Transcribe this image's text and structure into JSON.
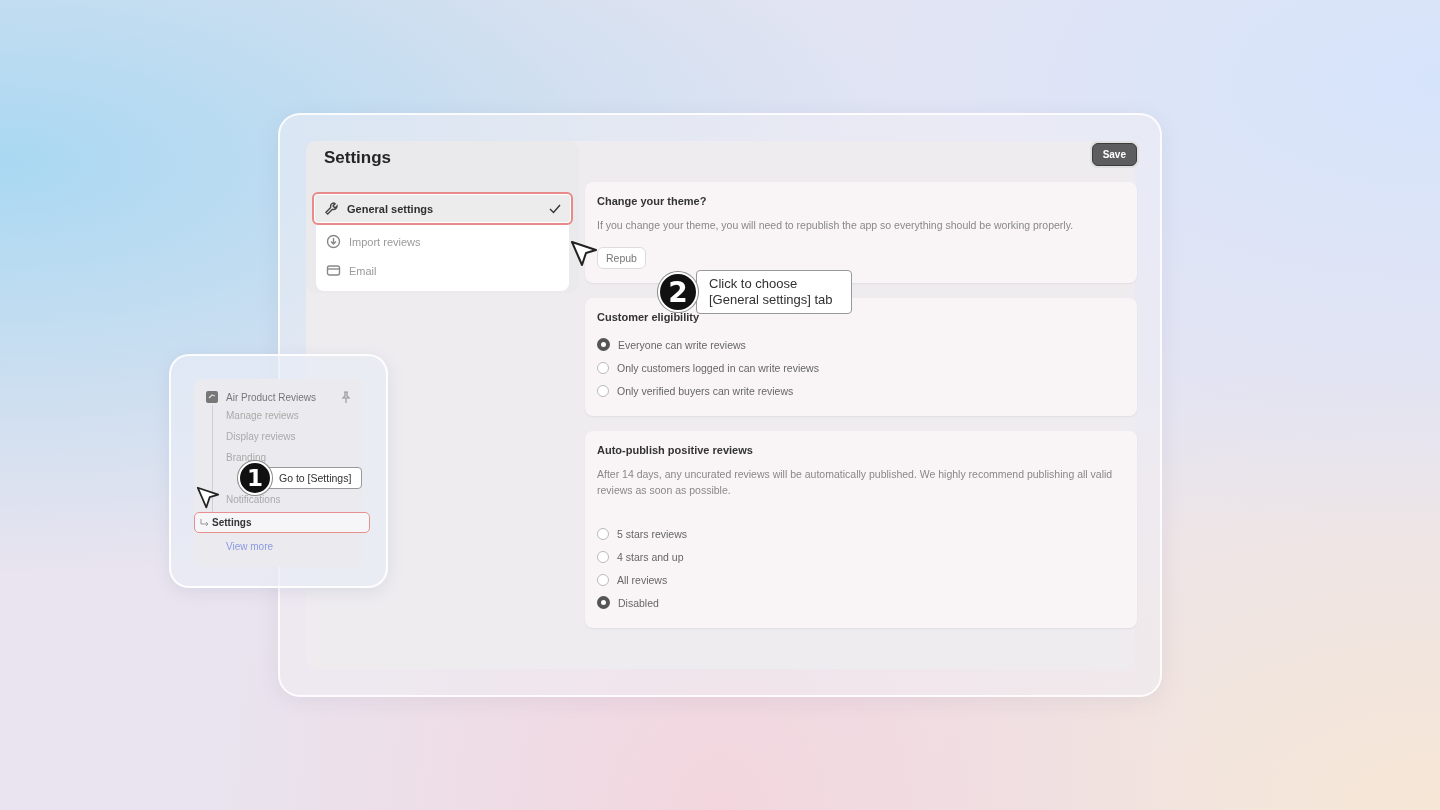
{
  "settings": {
    "title": "Settings",
    "save_button": "Save",
    "nav": [
      {
        "label": "General settings",
        "selected": true
      },
      {
        "label": "Import reviews",
        "selected": false
      },
      {
        "label": "Email",
        "selected": false
      }
    ],
    "cards": [
      {
        "kind": "text",
        "title": "Change your theme?",
        "description": "If you change your theme, you will need to republish the app so everything should be working properly.",
        "button": "Repub"
      },
      {
        "kind": "radio",
        "title": "Customer eligibility",
        "options": [
          {
            "label": "Everyone can write reviews",
            "selected": true
          },
          {
            "label": "Only customers logged in can write reviews",
            "selected": false
          },
          {
            "label": "Only verified buyers can write reviews",
            "selected": false
          }
        ]
      },
      {
        "kind": "radio",
        "title": "Auto-publish positive reviews",
        "description": "After 14 days, any uncurated reviews will be automatically published. We highly recommend publishing all valid reviews as soon as possible.",
        "options": [
          {
            "label": "5 stars reviews",
            "selected": false
          },
          {
            "label": "4 stars and up",
            "selected": false
          },
          {
            "label": "All reviews",
            "selected": false
          },
          {
            "label": "Disabled",
            "selected": true
          }
        ]
      }
    ]
  },
  "app_menu": {
    "title": "Air Product Reviews",
    "items": [
      {
        "label": "Manage reviews",
        "selected": false
      },
      {
        "label": "Display reviews",
        "selected": false
      },
      {
        "label": "Branding",
        "selected": false
      },
      {
        "label": "Notifications",
        "selected": false
      },
      {
        "label": "Settings",
        "selected": true
      }
    ],
    "more_link": "View more"
  },
  "steps": [
    {
      "number": "1",
      "text": "Go to [Settings]"
    },
    {
      "number": "2",
      "text": "Click to choose [General settings] tab"
    }
  ]
}
